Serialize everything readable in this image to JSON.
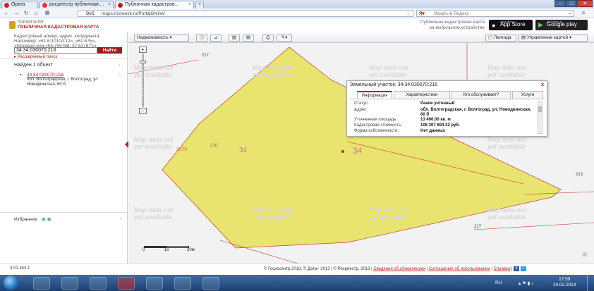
{
  "browser": {
    "tabs": [
      {
        "label": "Opera"
      },
      {
        "label": "росреестр публичная ..."
      },
      {
        "label": "Публичная кадастров..."
      }
    ],
    "url_site": "Веб",
    "url": "maps.rosreestr.ru/PortalOnline/",
    "search_placeholder": "Искать в Яндекс"
  },
  "header": {
    "portal_small": "ПОРТАЛ УСЛУГ",
    "portal_title": "ПУБЛИЧНАЯ КАДАСТРОВАЯ КАРТА",
    "promo_line1": "Публичная кадастровая карта",
    "promo_line2": "на мобильном устройстве",
    "appstore_small": "Доступно в",
    "appstore": "App Store",
    "gplay_small": "Доступно в",
    "gplay": "Google play"
  },
  "search": {
    "hint_line1": "Кадастровый номер, адрес, координата.",
    "hint_line2": "Например: «61:6:10104:12», «61:6:%»,",
    "hint_line3": "«Москва» или «55.755768, 37.617671»",
    "value": "34:34:030070:216",
    "button": "Найти",
    "advanced": "Расширенный поиск"
  },
  "results": {
    "found": "Найден 1 объект",
    "item_link": "34:34:030070:216",
    "item_addr": "обл. Волгоградская, г. Волгоград, ул Новодвинская, 60 б"
  },
  "favorites": {
    "label": "Избранное"
  },
  "toolbar": {
    "layer": "Недвижимость",
    "legend": "Легенда",
    "manage": "Управление картой"
  },
  "map": {
    "nodata_line1": "Map data not",
    "nodata_line2": "yet available",
    "labels": {
      "l217a": "217",
      "l217b": "217",
      "l213": "213",
      "l3470": "30:70",
      "l216": "216",
      "l34a": "34",
      "l34b": "34"
    }
  },
  "scale": {
    "ticks": [
      "0",
      "10",
      "20м"
    ]
  },
  "popup": {
    "title": "Земельный участок: 34:34:030070:216",
    "close": "x",
    "tabs": [
      "Информация",
      "Характеристики",
      "Кто обслуживает?",
      "Услуги"
    ],
    "rows": [
      {
        "label": "Статус:",
        "value": "Ранее учтенный"
      },
      {
        "label": "Адрес:",
        "value": "обл. Волгоградская, г. Волгоград, ул. Новодвинская, 60 б"
      },
      {
        "label": "Уточненная площадь:",
        "value": "13 496.00 кв. м"
      },
      {
        "label": "Кадастровая стоимость:",
        "value": "108 307 694.32 руб."
      },
      {
        "label": "Форма собственности:",
        "value": "Нет данных"
      }
    ]
  },
  "footer": {
    "version": "4.01.454.1",
    "copyright": "© Госиссентр 2013, © Дата+ 2013 | © Росреестр, 2013 |",
    "link1": "Сведения об обновлениях",
    "link2": "Соглашение об использовании",
    "link3": "Справка"
  },
  "taskbar": {
    "lang": "RU",
    "time": "17:59",
    "date": "24.02.2014"
  },
  "colors": {
    "parcel_fill": "#e9e46f",
    "border": "#c43a3a",
    "brand": "#b51f1f"
  }
}
